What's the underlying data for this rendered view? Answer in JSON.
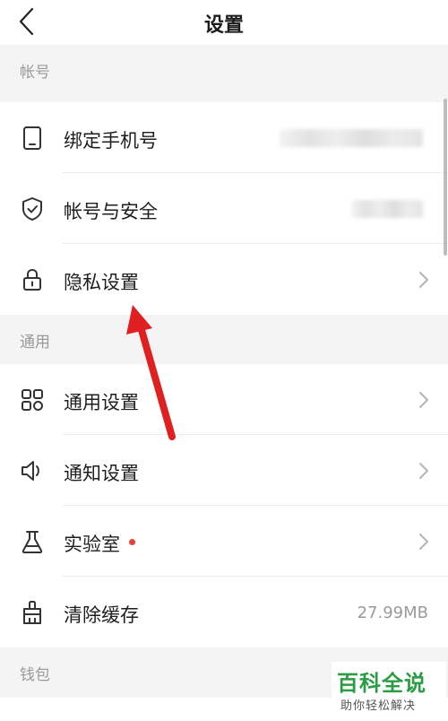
{
  "header": {
    "title": "设置",
    "back_icon": "chevron-left-icon"
  },
  "sections": [
    {
      "title": "帐号",
      "items": [
        {
          "label": "绑定手机号",
          "icon": "phone-icon",
          "value": "",
          "value_redacted": true
        },
        {
          "label": "帐号与安全",
          "icon": "shield-check-icon",
          "value": "",
          "value_redacted": true
        },
        {
          "label": "隐私设置",
          "icon": "lock-icon",
          "chevron": true
        }
      ]
    },
    {
      "title": "通用",
      "items": [
        {
          "label": "通用设置",
          "icon": "grid-icon",
          "chevron": true
        },
        {
          "label": "通知设置",
          "icon": "speaker-icon",
          "chevron": true
        },
        {
          "label": "实验室",
          "icon": "flask-icon",
          "chevron": true,
          "badge_dot": true
        },
        {
          "label": "清除缓存",
          "icon": "broom-icon",
          "value": "27.99MB"
        }
      ]
    },
    {
      "title": "钱包",
      "items": []
    }
  ],
  "watermark": {
    "title": "百科全说",
    "subtitle": "助你轻松解决"
  },
  "colors": {
    "background": "#f4f4f4",
    "card": "#ffffff",
    "section_text": "#9a9a9a",
    "arrow": "#e02020",
    "badge_dot": "#e8413c",
    "watermark_green": "#2b9c44"
  }
}
